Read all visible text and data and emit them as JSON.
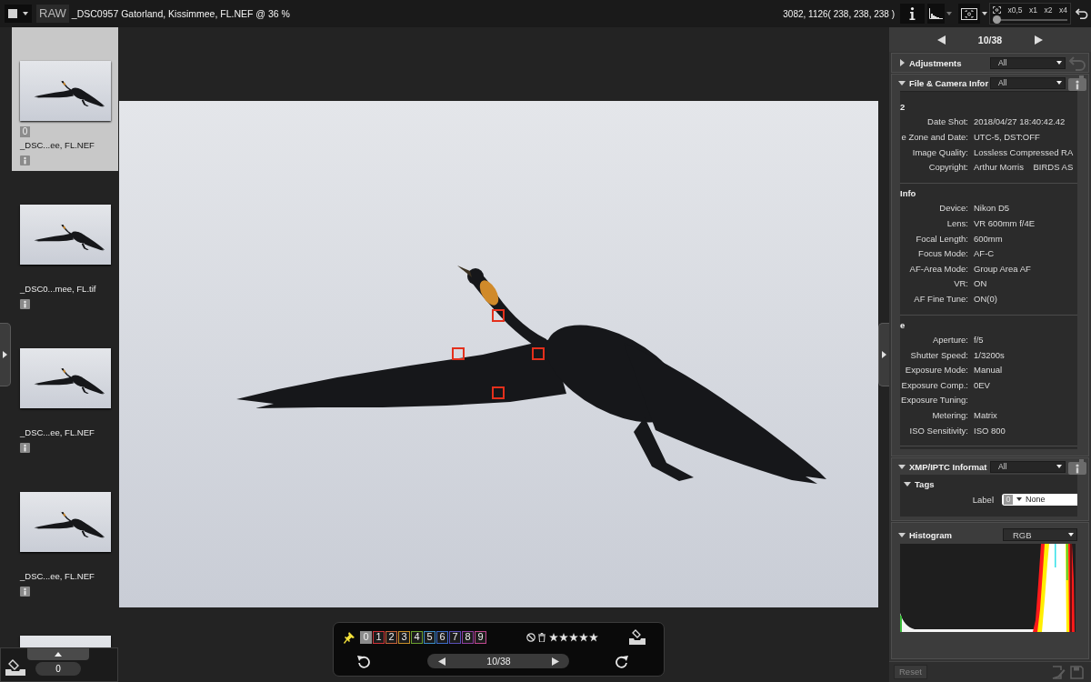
{
  "toolbar": {
    "format": "RAW",
    "title": "_DSC0957 Gatorland, Kissimmee, FL.NEF @ 36 %",
    "pixel_readout": "3082, 1126( 238, 238, 238 )",
    "zoom": {
      "labels": [
        "x0,5",
        "x1",
        "x2",
        "x4"
      ],
      "level": 0
    }
  },
  "filmstrip": {
    "items": [
      {
        "selected": true,
        "label": "0",
        "filename": "_DSC...ee, FL.NEF"
      },
      {
        "selected": false,
        "filename": "_DSC0...mee, FL.tif"
      },
      {
        "selected": false,
        "filename": "_DSC...ee, FL.NEF"
      },
      {
        "selected": false,
        "filename": "_DSC...ee, FL.NEF"
      },
      {
        "selected": false
      }
    ],
    "counter": "0"
  },
  "viewer": {
    "bottom_bar": {
      "labels": [
        {
          "text": "0",
          "color": "#8c8c8c",
          "selected": true
        },
        {
          "text": "1",
          "color": "#d0343a",
          "selected": false
        },
        {
          "text": "2",
          "color": "#c8643c",
          "selected": false
        },
        {
          "text": "3",
          "color": "#c8902a",
          "selected": false
        },
        {
          "text": "4",
          "color": "#6aa030",
          "selected": false
        },
        {
          "text": "5",
          "color": "#3c8cc8",
          "selected": false
        },
        {
          "text": "6",
          "color": "#3c6cc8",
          "selected": false
        },
        {
          "text": "7",
          "color": "#5a50b8",
          "selected": false
        },
        {
          "text": "8",
          "color": "#9040a0",
          "selected": false
        },
        {
          "text": "9",
          "color": "#c04890",
          "selected": false
        }
      ],
      "stars": 5,
      "position": "10/38"
    }
  },
  "right_panel": {
    "position": "10/38",
    "sections": [
      {
        "kind": "adjustments",
        "title": "Adjustments",
        "expanded": false,
        "filter": "All"
      },
      {
        "kind": "info",
        "title": "File & Camera Infor",
        "expanded": true,
        "filter": "All",
        "groups": [
          {
            "heading": "2",
            "rows": [
              {
                "label": "Date Shot:",
                "value": "2018/04/27 18:40:42.42"
              },
              {
                "label": "e Zone and Date:",
                "value": "UTC-5, DST:OFF"
              },
              {
                "label": "Image Quality:",
                "value": "Lossless Compressed RA"
              },
              {
                "label": "Copyright:",
                "value": "Arthur Morris    BIRDS AS"
              }
            ]
          },
          {
            "heading": "Info",
            "rows": [
              {
                "label": "Device:",
                "value": "Nikon D5"
              },
              {
                "label": "Lens:",
                "value": "VR 600mm f/4E"
              },
              {
                "label": "Focal Length:",
                "value": "600mm"
              },
              {
                "label": "Focus Mode:",
                "value": "AF-C"
              },
              {
                "label": "AF-Area Mode:",
                "value": "Group Area AF"
              },
              {
                "label": "VR:",
                "value": "ON"
              },
              {
                "label": "AF Fine Tune:",
                "value": "ON(0)"
              }
            ]
          },
          {
            "heading": "e",
            "rows": [
              {
                "label": "Aperture:",
                "value": "f/5"
              },
              {
                "label": "Shutter Speed:",
                "value": "1/3200s"
              },
              {
                "label": "Exposure Mode:",
                "value": "Manual"
              },
              {
                "label": "Exposure Comp.:",
                "value": "0EV"
              },
              {
                "label": "Exposure Tuning:"
              },
              {
                "label": "Metering:",
                "value": "Matrix"
              },
              {
                "label": "ISO Sensitivity:",
                "value": "ISO 800"
              }
            ]
          }
        ]
      },
      {
        "kind": "tags",
        "title": "XMP/IPTC Informat",
        "expanded": true,
        "filter": "All",
        "group": {
          "heading": "Tags",
          "expanded": true,
          "field": {
            "label": "Label",
            "badge": "0",
            "value": "None"
          }
        }
      },
      {
        "kind": "histogram",
        "title": "Histogram",
        "expanded": true,
        "channel": "RGB"
      }
    ],
    "reset": {
      "text": "Reset",
      "disabled": true
    }
  }
}
